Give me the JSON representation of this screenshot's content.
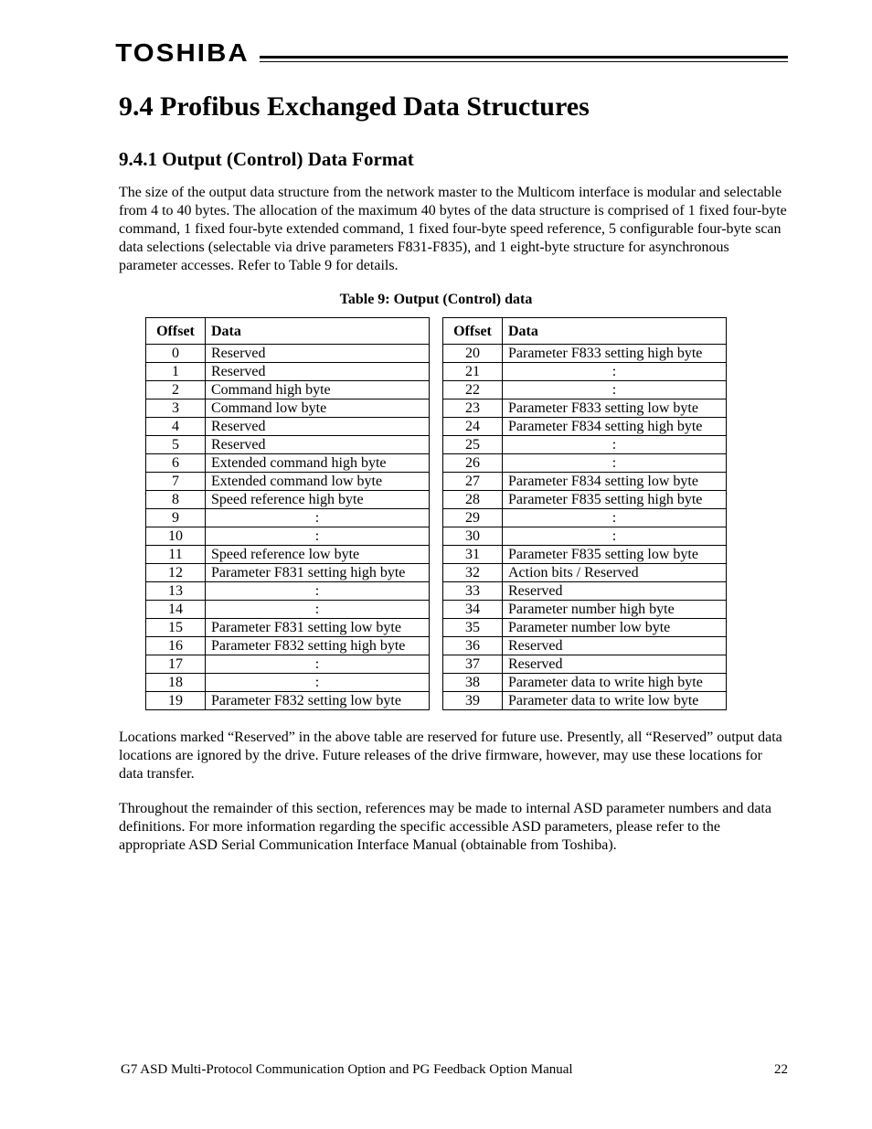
{
  "brand": "TOSHIBA",
  "section_title": "9.4  Profibus Exchanged Data Structures",
  "subsection_title": "9.4.1  Output (Control) Data Format",
  "para1": "The size of the output data structure from the network master to the Multicom interface is modular and selectable from 4 to 40 bytes.  The allocation of the maximum 40 bytes of the data structure is comprised of 1 fixed four-byte command, 1 fixed four-byte extended command, 1 fixed four-byte speed reference, 5 configurable four-byte scan data selections (selectable via drive parameters F831-F835), and 1 eight-byte structure for asynchronous parameter accesses.  Refer to Table 9 for details.",
  "table_caption": "Table 9: Output (Control) data",
  "table_headers": {
    "offset": "Offset",
    "data": "Data"
  },
  "table_left": [
    {
      "o": "0",
      "d": "Reserved",
      "c": false
    },
    {
      "o": "1",
      "d": "Reserved",
      "c": false
    },
    {
      "o": "2",
      "d": "Command high byte",
      "c": false
    },
    {
      "o": "3",
      "d": "Command low byte",
      "c": false
    },
    {
      "o": "4",
      "d": "Reserved",
      "c": false
    },
    {
      "o": "5",
      "d": "Reserved",
      "c": false
    },
    {
      "o": "6",
      "d": "Extended command high byte",
      "c": false
    },
    {
      "o": "7",
      "d": "Extended command low byte",
      "c": false
    },
    {
      "o": "8",
      "d": "Speed reference high byte",
      "c": false
    },
    {
      "o": "9",
      "d": ":",
      "c": true
    },
    {
      "o": "10",
      "d": ":",
      "c": true
    },
    {
      "o": "11",
      "d": "Speed reference low byte",
      "c": false
    },
    {
      "o": "12",
      "d": "Parameter F831 setting high byte",
      "c": false
    },
    {
      "o": "13",
      "d": ":",
      "c": true
    },
    {
      "o": "14",
      "d": ":",
      "c": true
    },
    {
      "o": "15",
      "d": "Parameter F831 setting low byte",
      "c": false
    },
    {
      "o": "16",
      "d": "Parameter F832 setting high byte",
      "c": false
    },
    {
      "o": "17",
      "d": ":",
      "c": true
    },
    {
      "o": "18",
      "d": ":",
      "c": true
    },
    {
      "o": "19",
      "d": "Parameter F832 setting low byte",
      "c": false
    }
  ],
  "table_right": [
    {
      "o": "20",
      "d": "Parameter F833 setting high byte",
      "c": false
    },
    {
      "o": "21",
      "d": ":",
      "c": true
    },
    {
      "o": "22",
      "d": ":",
      "c": true
    },
    {
      "o": "23",
      "d": "Parameter F833 setting low byte",
      "c": false
    },
    {
      "o": "24",
      "d": "Parameter F834 setting high byte",
      "c": false
    },
    {
      "o": "25",
      "d": ":",
      "c": true
    },
    {
      "o": "26",
      "d": ":",
      "c": true
    },
    {
      "o": "27",
      "d": "Parameter F834 setting low byte",
      "c": false
    },
    {
      "o": "28",
      "d": "Parameter F835 setting high byte",
      "c": false
    },
    {
      "o": "29",
      "d": ":",
      "c": true
    },
    {
      "o": "30",
      "d": ":",
      "c": true
    },
    {
      "o": "31",
      "d": "Parameter F835 setting low byte",
      "c": false
    },
    {
      "o": "32",
      "d": "Action bits / Reserved",
      "c": false
    },
    {
      "o": "33",
      "d": "Reserved",
      "c": false
    },
    {
      "o": "34",
      "d": "Parameter number high byte",
      "c": false
    },
    {
      "o": "35",
      "d": "Parameter number low byte",
      "c": false
    },
    {
      "o": "36",
      "d": "Reserved",
      "c": false
    },
    {
      "o": "37",
      "d": "Reserved",
      "c": false
    },
    {
      "o": "38",
      "d": "Parameter data to write high byte",
      "c": false
    },
    {
      "o": "39",
      "d": "Parameter data to write low byte",
      "c": false
    }
  ],
  "para2": "Locations marked “Reserved” in the above table are reserved for future use.  Presently, all “Reserved” output data locations are ignored by the drive.  Future releases of the drive firmware, however, may use these locations for data transfer.",
  "para3": "Throughout the remainder of this section, references may be made to internal ASD parameter numbers and data definitions.  For more information regarding the specific accessible ASD parameters, please refer to the appropriate ASD Serial Communication Interface Manual (obtainable from Toshiba).",
  "footer_left": "G7 ASD Multi-Protocol Communication Option and PG Feedback Option Manual",
  "footer_right": "22"
}
